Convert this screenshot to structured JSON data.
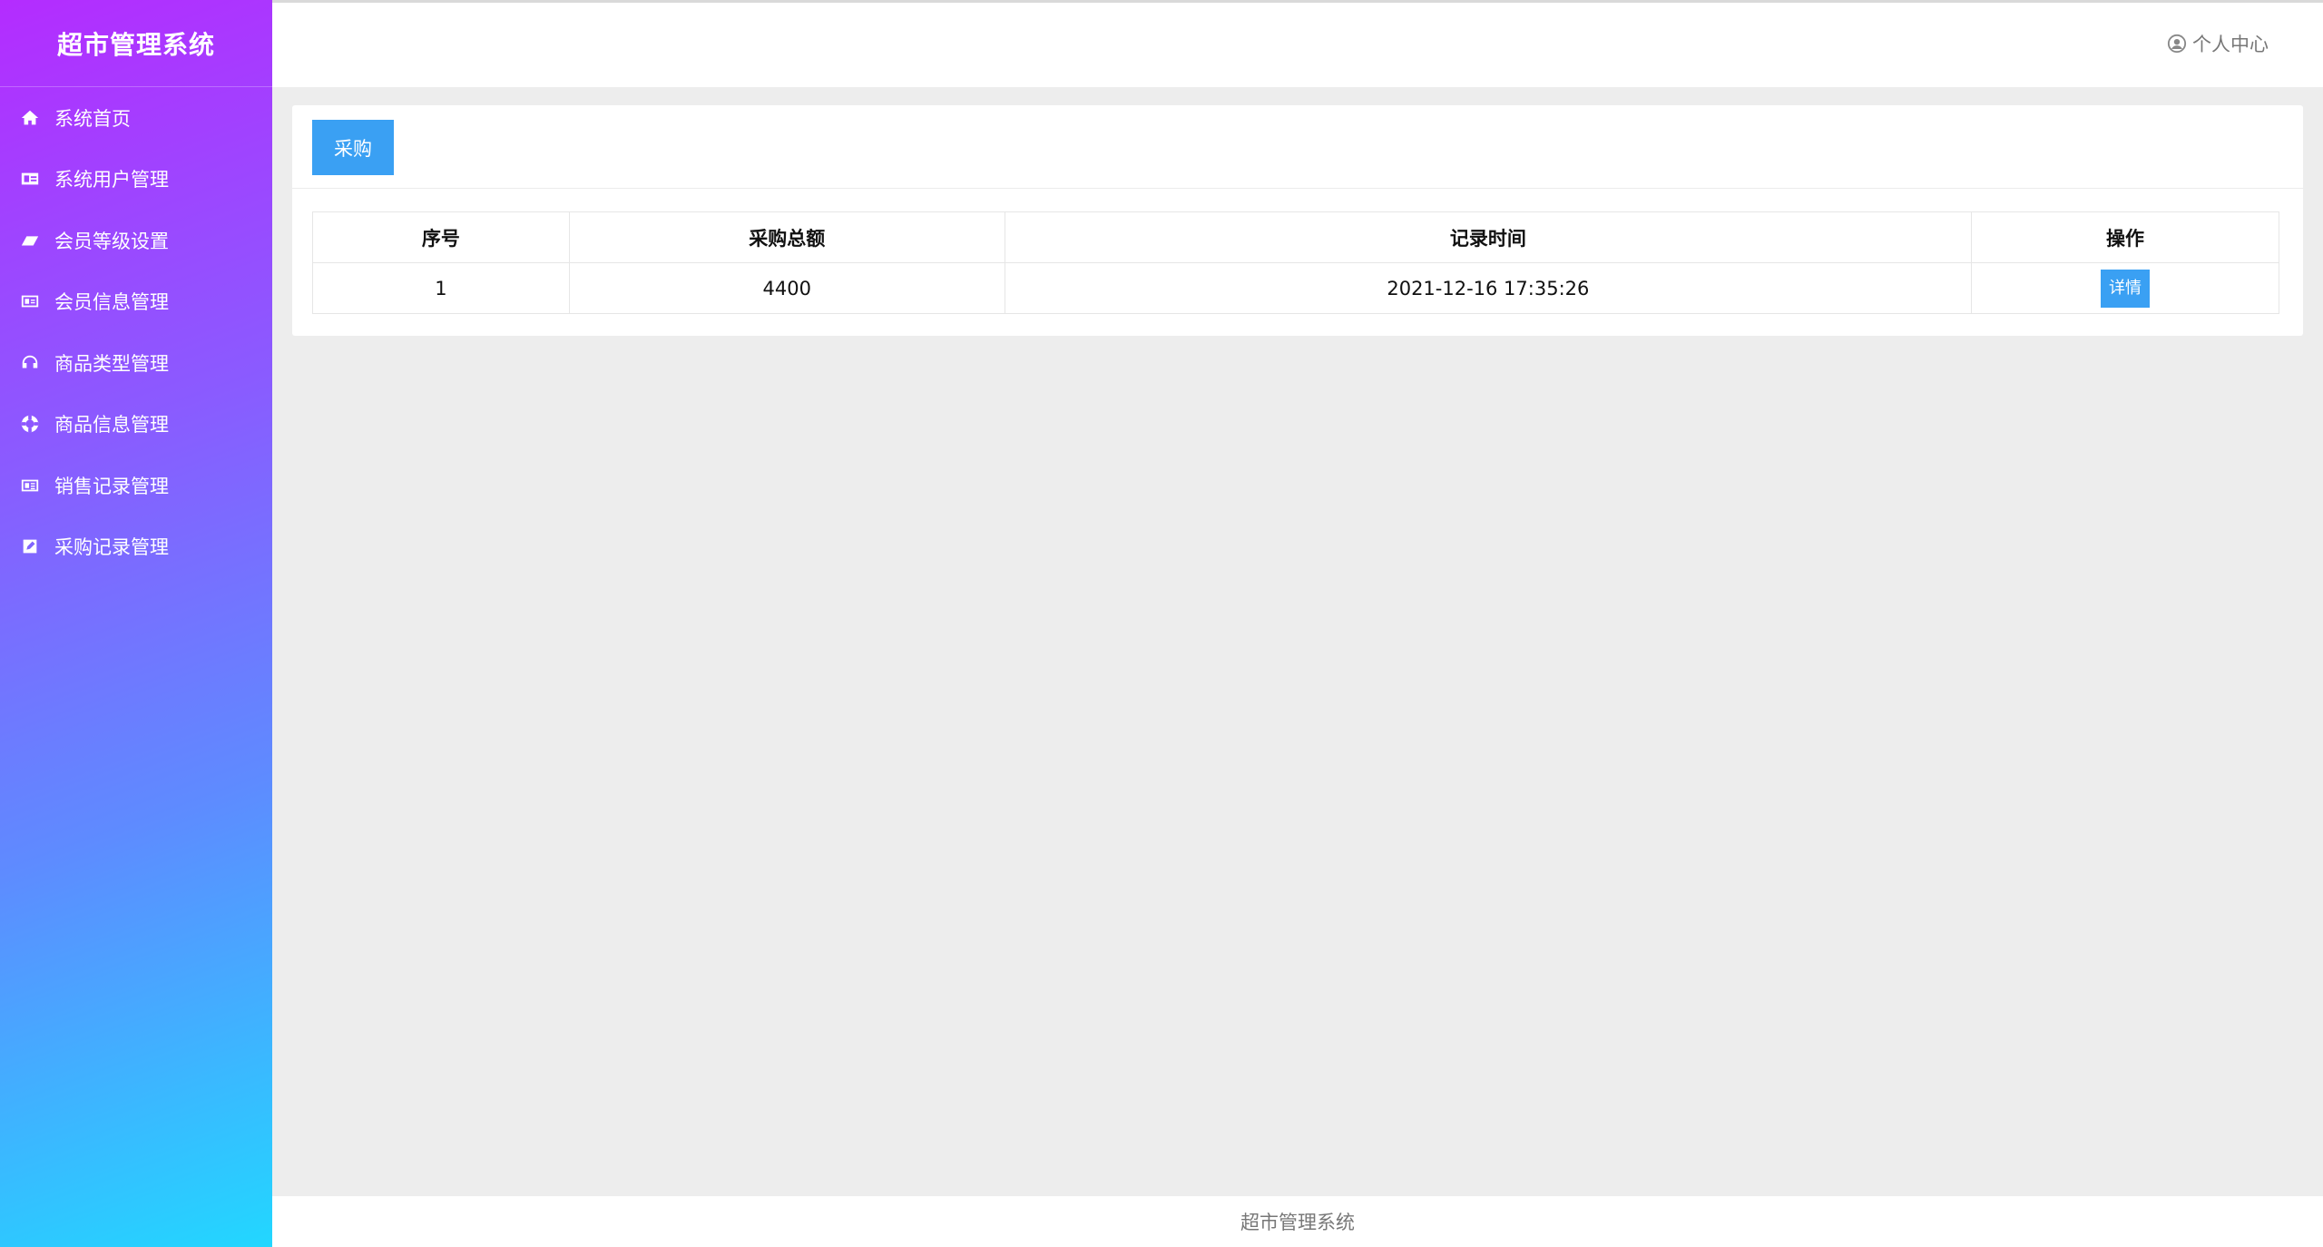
{
  "sidebar": {
    "title": "超市管理系统",
    "items": [
      {
        "label": "系统首页",
        "icon": "home-icon"
      },
      {
        "label": "系统用户管理",
        "icon": "id-card-icon"
      },
      {
        "label": "会员等级设置",
        "icon": "eraser-icon"
      },
      {
        "label": "会员信息管理",
        "icon": "id-card-icon"
      },
      {
        "label": "商品类型管理",
        "icon": "headphones-icon"
      },
      {
        "label": "商品信息管理",
        "icon": "life-ring-icon"
      },
      {
        "label": "销售记录管理",
        "icon": "newspaper-icon"
      },
      {
        "label": "采购记录管理",
        "icon": "edit-icon"
      }
    ]
  },
  "header": {
    "user_center": "个人中心"
  },
  "toolbar": {
    "purchase_label": "采购"
  },
  "table": {
    "headers": [
      "序号",
      "采购总额",
      "记录时间",
      "操作"
    ],
    "rows": [
      {
        "index": "1",
        "total": "4400",
        "time": "2021-12-16 17:35:26",
        "action": "详情"
      }
    ]
  },
  "footer": {
    "text": "超市管理系统"
  },
  "colors": {
    "accent": "#3aa0f3",
    "sidebar_gradient_start": "#b42cff",
    "sidebar_gradient_end": "#22d7ff"
  }
}
